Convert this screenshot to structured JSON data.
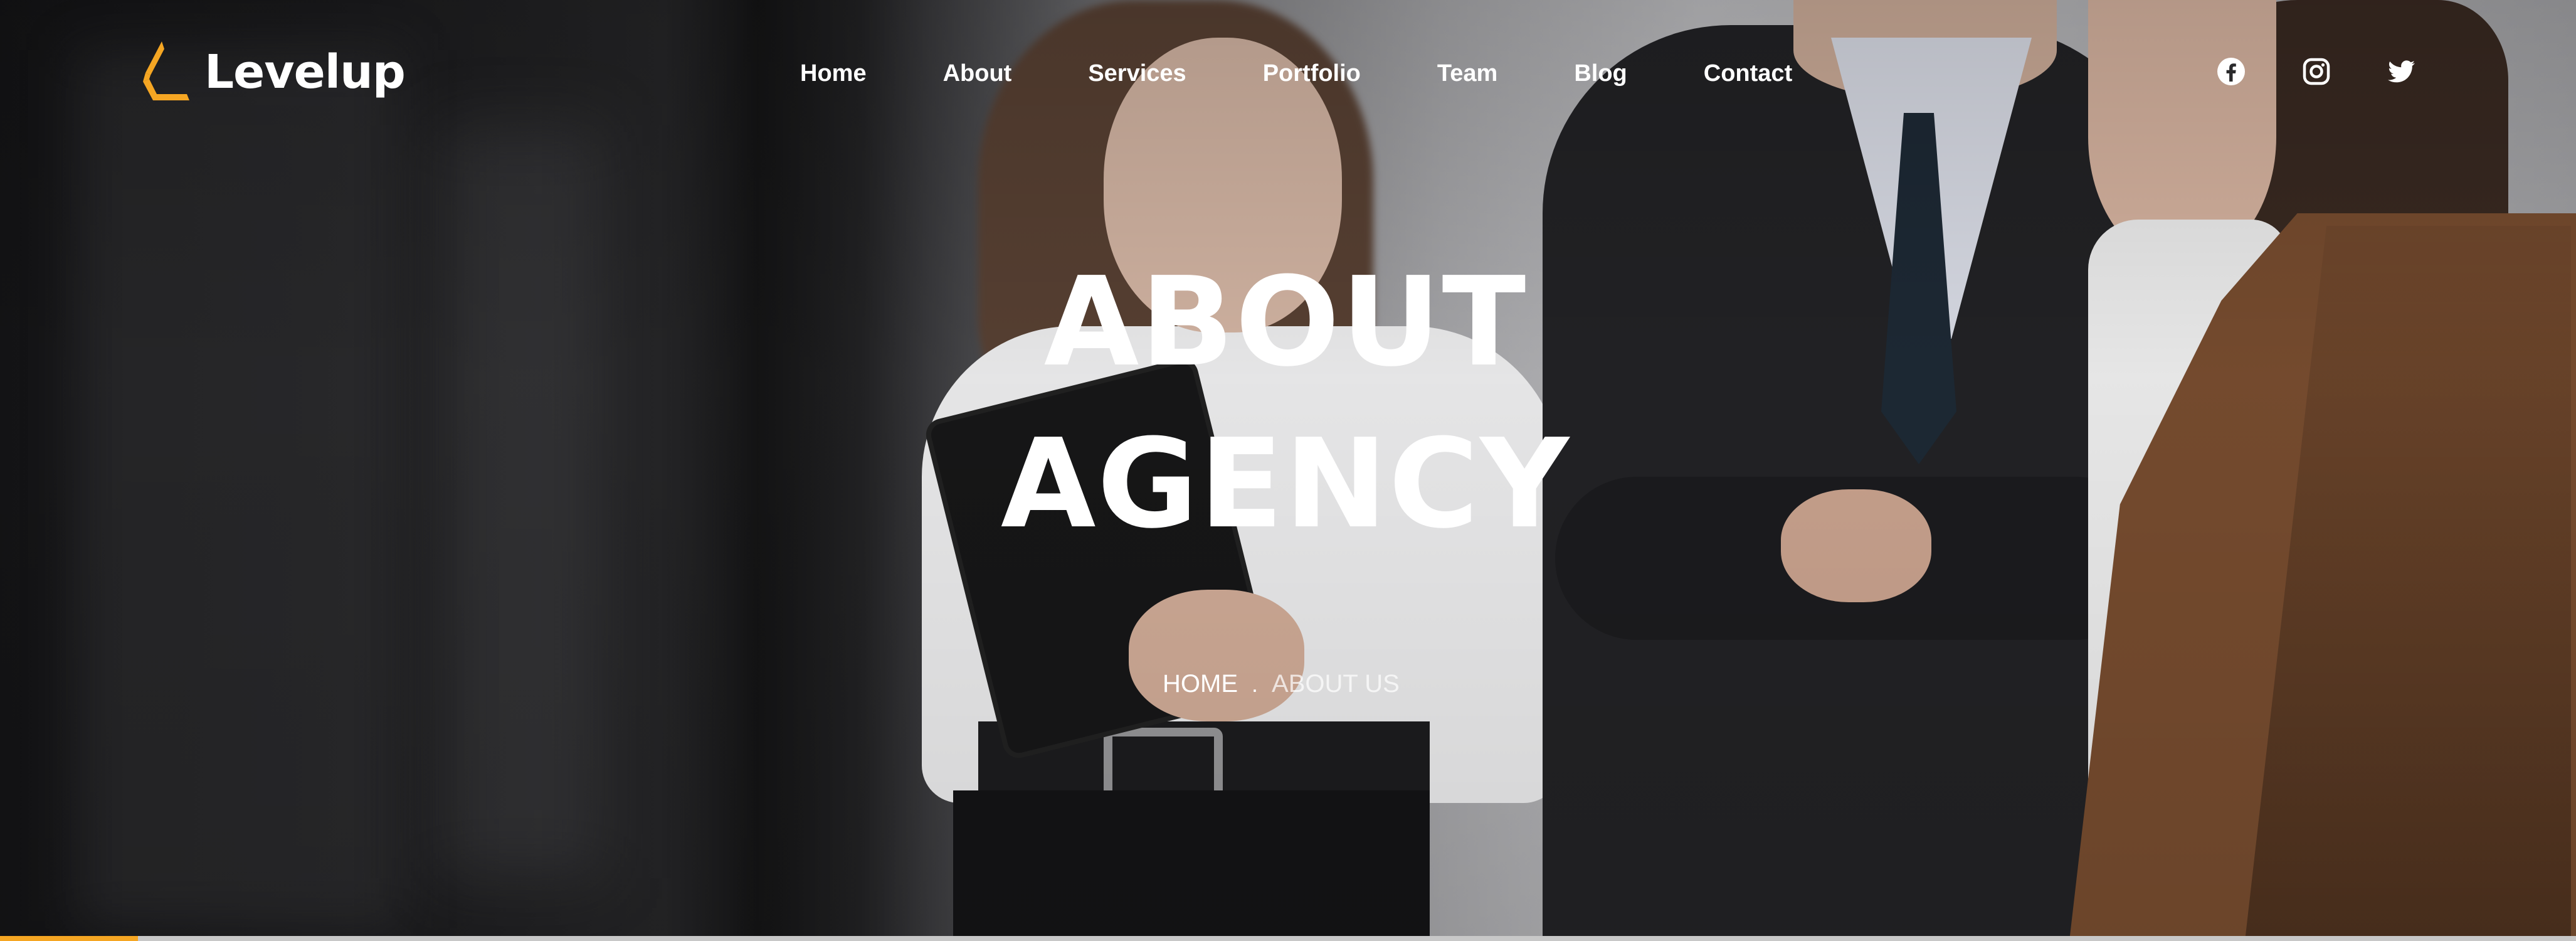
{
  "brand": {
    "name": "Levelup",
    "accent_color": "#f5a623",
    "logo_icon": "levelup-logo-icon"
  },
  "nav": {
    "items": [
      {
        "label": "Home"
      },
      {
        "label": "About"
      },
      {
        "label": "Services"
      },
      {
        "label": "Portfolio"
      },
      {
        "label": "Team"
      },
      {
        "label": "Blog"
      },
      {
        "label": "Contact"
      }
    ]
  },
  "social": {
    "icons": [
      "facebook-icon",
      "instagram-icon",
      "twitter-icon"
    ]
  },
  "hero": {
    "title_line1": "ABOUT",
    "title_line2": "AGENCY",
    "breadcrumb": {
      "home": "HOME",
      "separator": ".",
      "current": "ABOUT US"
    }
  }
}
